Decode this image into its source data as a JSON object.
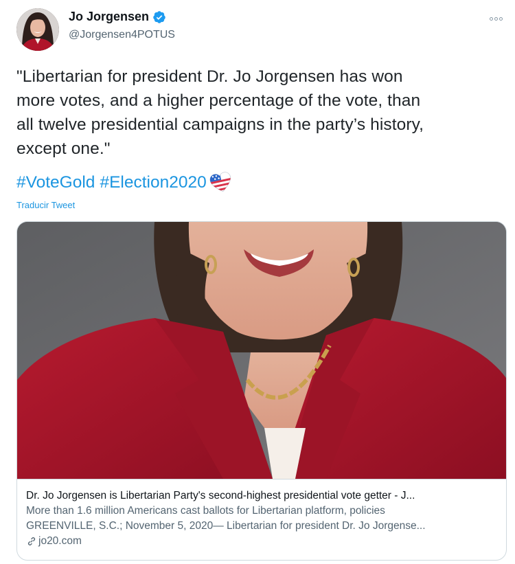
{
  "author": {
    "display_name": "Jo Jorgensen",
    "handle": "@Jorgensen4POTUS",
    "verified": true,
    "avatar_icon": "avatar-photo"
  },
  "tweet": {
    "text_lines": [
      "\"Libertarian for president Dr. Jo Jorgensen has won",
      "more votes, and a higher percentage of the vote, than",
      "all twelve presidential campaigns in the party’s history,",
      "except one.\""
    ],
    "hashtags": [
      "#VoteGold",
      "#Election2020"
    ],
    "translate_label": "Traducir Tweet"
  },
  "link_card": {
    "title": "Dr. Jo Jorgensen is Libertarian Party's second-highest presidential vote getter - J...",
    "description_lines": [
      "More than 1.6 million Americans cast ballots for Libertarian platform, policies",
      "GREENVILLE, S.C.; November 5, 2020— Libertarian for president Dr. Jo Jorgense..."
    ],
    "domain": "jo20.com",
    "image_icon": "portrait-photo"
  },
  "colors": {
    "link_blue": "#1b95e0",
    "verified_blue": "#1d9bf0",
    "muted_text": "#536471",
    "border": "#cfd9de",
    "jacket_red": "#a8152a"
  }
}
